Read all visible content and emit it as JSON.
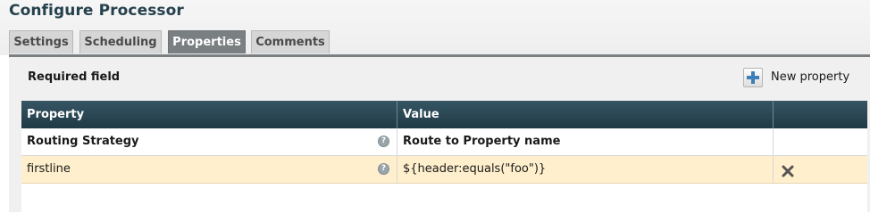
{
  "dialog": {
    "title": "Configure Processor"
  },
  "tabs": [
    {
      "label": "Settings",
      "active": false
    },
    {
      "label": "Scheduling",
      "active": false
    },
    {
      "label": "Properties",
      "active": true
    },
    {
      "label": "Comments",
      "active": false
    }
  ],
  "properties": {
    "required_field_label": "Required field",
    "new_property_label": "New property",
    "columns": [
      "Property",
      "Value",
      ""
    ],
    "rows": [
      {
        "property": "Routing Strategy",
        "value": "Route to Property name",
        "bold": true,
        "deletable": false
      },
      {
        "property": "firstline",
        "value": "${header:equals(\"foo\")}",
        "bold": false,
        "deletable": true
      }
    ],
    "help_glyph": "?"
  },
  "icons": {
    "add": "plus-icon",
    "delete": "close-x-icon",
    "help": "help-icon"
  },
  "colors": {
    "title": "#26414e",
    "active_tab": "#7a7f82",
    "table_header": "#2a4654",
    "highlight_row": "#ffefcc",
    "plus": "#3d7fb8"
  }
}
